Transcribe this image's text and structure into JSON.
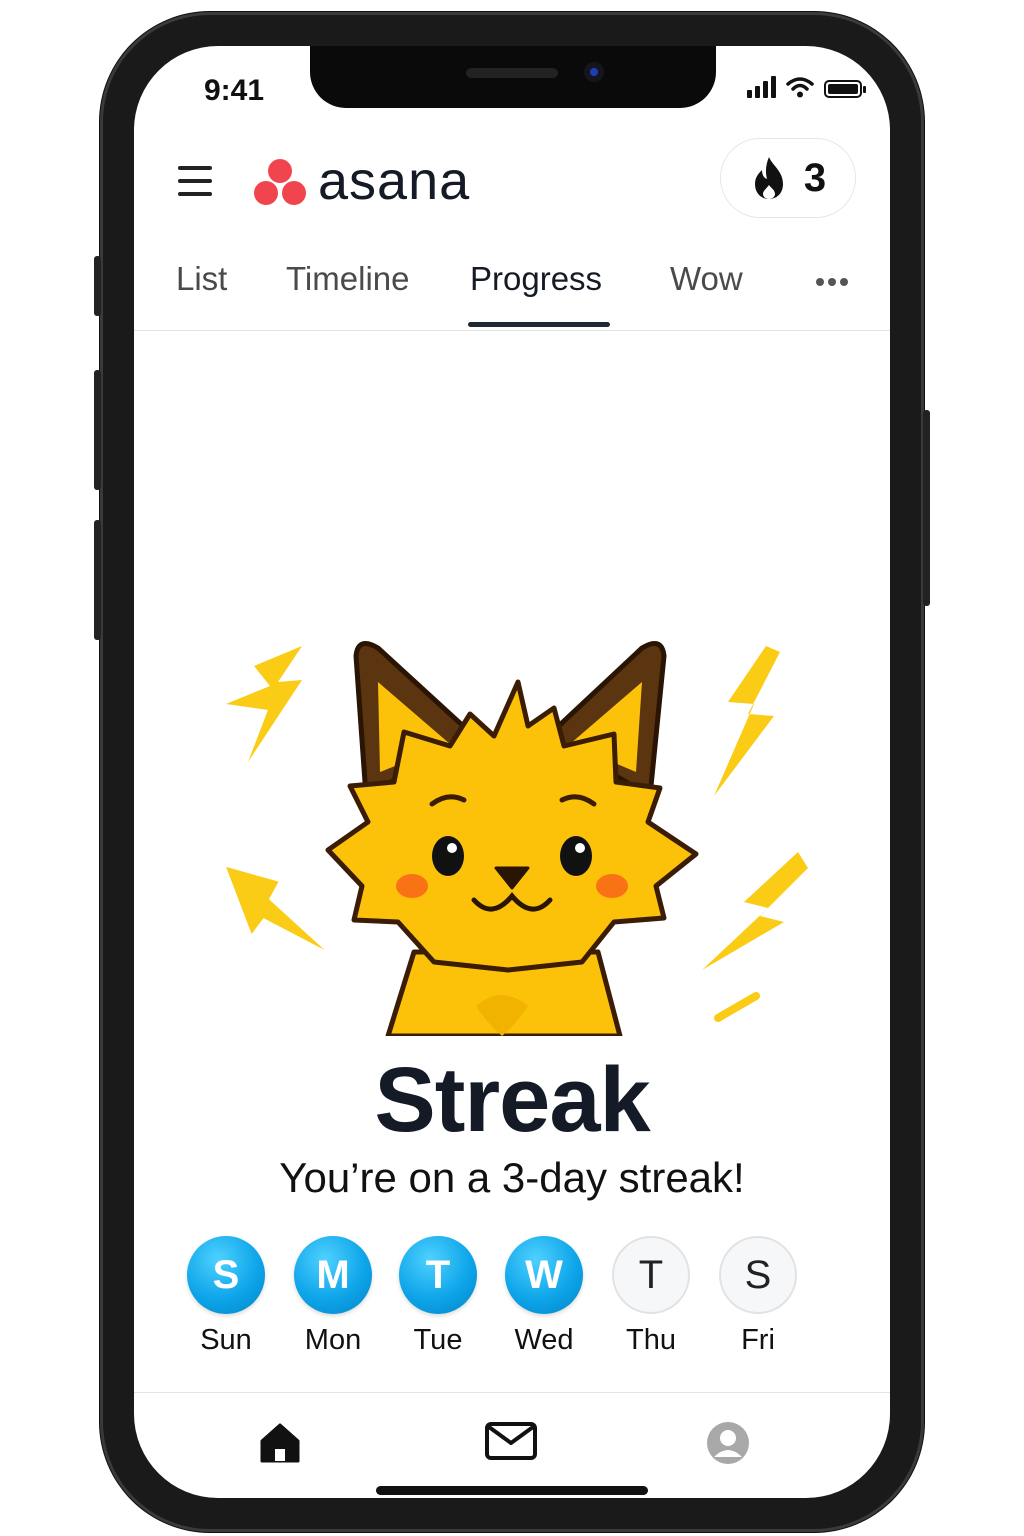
{
  "status_bar": {
    "time": "9:41"
  },
  "header": {
    "logo_text": "asana",
    "streak_count": "3",
    "icons": {
      "menu": "hamburger-menu-icon",
      "streak": "flame-icon"
    }
  },
  "tabs": [
    {
      "label": "List"
    },
    {
      "label": "Timeline"
    },
    {
      "label": "Progress",
      "active": true
    },
    {
      "label": "Wow"
    }
  ],
  "streak": {
    "title": "Streak",
    "message": "You’re on a 3-day streak!",
    "days": [
      {
        "letter": "S",
        "label": "Sun",
        "done": true
      },
      {
        "letter": "M",
        "label": "Mon",
        "done": true
      },
      {
        "letter": "T",
        "label": "Tue",
        "done": true
      },
      {
        "letter": "W",
        "label": "Wed",
        "done": true
      },
      {
        "letter": "T",
        "label": "Thu",
        "done": false
      },
      {
        "letter": "S",
        "label": "Fri",
        "done": false
      }
    ]
  },
  "bottom_nav": [
    "home-icon",
    "inbox-icon",
    "profile-icon"
  ],
  "colors": {
    "brand": "#f0454f",
    "streak_done": "#0ea5e9",
    "mascot": "#fcc20a",
    "text_dark": "#151b26"
  }
}
